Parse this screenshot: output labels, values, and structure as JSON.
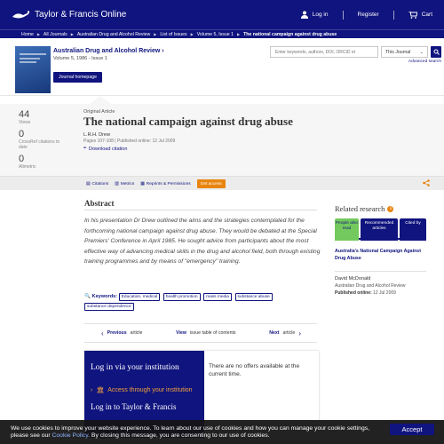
{
  "header": {
    "brand": "Taylor & Francis Online",
    "login": "Log in",
    "register": "Register",
    "cart": "Cart"
  },
  "breadcrumb": [
    "Home",
    "All Journals",
    "Australian Drug and Alcohol Review",
    "List of Issues",
    "Volume 5, Issue 1",
    "The national campaign against drug abuse"
  ],
  "journal": {
    "title": "Australian Drug and Alcohol Review",
    "title_arrow": "›",
    "volume": "Volume 5, 1986 - Issue 1",
    "homepage_button": "Journal homepage"
  },
  "search": {
    "placeholder": "Enter keywords, authors, DOI, ORCID et",
    "scope": "This Journal",
    "advanced": "Advanced search"
  },
  "metrics": [
    {
      "value": "44",
      "label": "Views"
    },
    {
      "value": "0",
      "label": "CrossRef citations to date"
    },
    {
      "value": "0",
      "label": "Altmetric"
    }
  ],
  "article": {
    "type": "Original Article",
    "title": "The national campaign against drug abuse",
    "author": "L.R.H. Drew",
    "pages": "Pages 107-108 | Published online: 12 Jul 2009",
    "download": "Download citation"
  },
  "actions": {
    "citations": "Citations",
    "metrics": "Metrics",
    "reprints": "Reprints & Permissions",
    "get_access": "Get access"
  },
  "abstract": {
    "heading": "Abstract",
    "text": "In his presentation Dr Drew outlined the aims and the strategies contemplated for the forthcoming national campaign against drug abuse. They would be debated at the Special Premiers' Conference in April 1985. He sought advice from participants about the most effective way of advancing medical skills in the drug and alcohol field, both through existing training programmes and by means of \"emergency\" training."
  },
  "keywords": {
    "label": "Keywords:",
    "items": [
      "Education, medical",
      "health promotion",
      "mass media",
      "substance abuse",
      "substance dependence"
    ]
  },
  "navigation": {
    "previous_bold": "Previous",
    "previous_light": "article",
    "view_bold": "View",
    "view_light": "issue table of contents",
    "next_bold": "Next",
    "next_light": "article"
  },
  "login_box": {
    "heading": "Log in via your institution",
    "institution": "Access through your institution",
    "tf_partial": "Log in to Taylor & Francis",
    "offers": "There are no offers available at the current time."
  },
  "related": {
    "heading": "Related research",
    "tabs": [
      "People also read",
      "Recommended articles",
      "Cited by"
    ],
    "item_title": "Australia's National Campaign Against Drug Abuse",
    "item_author": "David McDonald",
    "item_journal": "Australian Drug and Alcohol Review",
    "item_published_label": "Published online:",
    "item_published_date": "12 Jul 2009"
  },
  "cookie": {
    "line1": "We use cookies to improve your website experience. To learn about our use of cookies and how you can manage your cookie settings,",
    "line2_pre": "please see our",
    "line2_link": "Cookie Policy",
    "line2_post": ". By closing this message, you are consenting to our use of cookies.",
    "accept": "Accept"
  },
  "colors": {
    "brand_navy": "#10147e",
    "accent_orange": "#e88511",
    "tab_green": "#73c95d"
  },
  "icons": [
    "logo-lamp-icon",
    "user-icon",
    "cart-icon",
    "search-icon",
    "info-icon",
    "quote-icon",
    "share-icon",
    "institution-icon"
  ]
}
